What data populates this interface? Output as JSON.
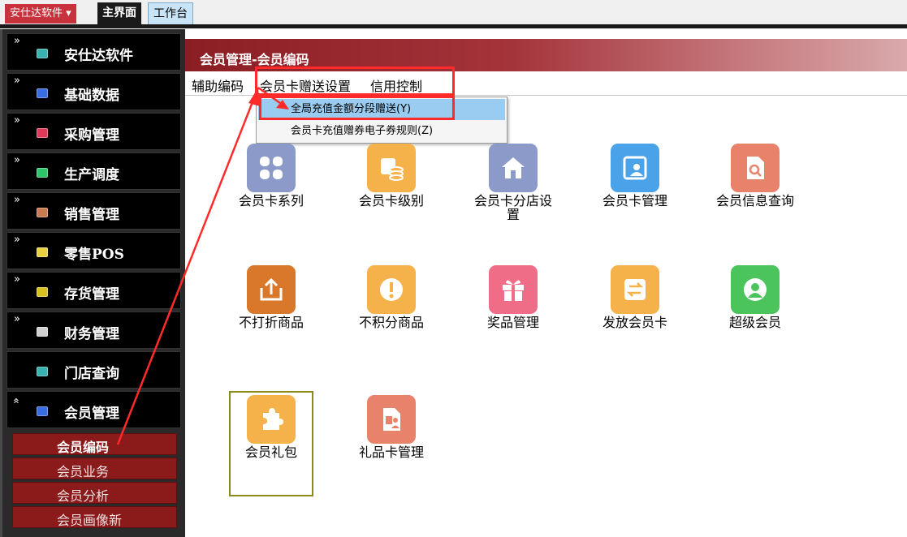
{
  "topbar": {
    "app_menu": "安仕达软件 ▾",
    "tabs": [
      "主界面",
      "工作台"
    ]
  },
  "sidebar": {
    "items": [
      {
        "label": "安仕达软件",
        "chevron": "»",
        "color": "#3ab0b0"
      },
      {
        "label": "基础数据",
        "chevron": "»",
        "color": "#3a6ee0"
      },
      {
        "label": "采购管理",
        "chevron": "»",
        "color": "#e03a5a"
      },
      {
        "label": "生产调度",
        "chevron": "»",
        "color": "#2ec46a"
      },
      {
        "label": "销售管理",
        "chevron": "»",
        "color": "#c87a50"
      },
      {
        "label": "零售POS",
        "chevron": "»",
        "color": "#e8d040"
      },
      {
        "label": "存货管理",
        "chevron": "»",
        "color": "#d8c020"
      },
      {
        "label": "财务管理",
        "chevron": "»",
        "color": "#d0d0d0"
      },
      {
        "label": "门店查询",
        "chevron": "",
        "color": "#3ab0b0"
      },
      {
        "label": "会员管理",
        "chevron": "«",
        "color": "#3a6ee0"
      }
    ],
    "subitems": [
      {
        "label": "会员编码",
        "active": true
      },
      {
        "label": "会员业务",
        "active": false
      },
      {
        "label": "会员分析",
        "active": false
      },
      {
        "label": "会员画像新",
        "active": false
      }
    ]
  },
  "panel": {
    "title": "会员管理-会员编码",
    "menu": [
      "辅助编码",
      "会员卡赠送设置",
      "信用控制"
    ],
    "dropdown": [
      {
        "label": "全局充值金额分段赠送(Y)",
        "highlighted": true
      },
      {
        "label": "会员卡充值赠券电子券规则(Z)",
        "highlighted": false
      }
    ]
  },
  "tiles": [
    {
      "label": "会员卡系列",
      "icon": "grid-icon",
      "color": "#8b9ac9"
    },
    {
      "label": "会员卡级别",
      "icon": "coins-icon",
      "color": "#f5b24a"
    },
    {
      "label": "会员卡分店设置",
      "icon": "home-icon",
      "color": "#8b9ac9"
    },
    {
      "label": "会员卡管理",
      "icon": "id-card-icon",
      "color": "#4aa3e8"
    },
    {
      "label": "会员信息查询",
      "icon": "doc-search-icon",
      "color": "#e8826a"
    },
    {
      "label": "不打折商品",
      "icon": "upload-icon",
      "color": "#d9782a"
    },
    {
      "label": "不积分商品",
      "icon": "alert-icon",
      "color": "#f5b24a"
    },
    {
      "label": "奖品管理",
      "icon": "gift-icon",
      "color": "#ef6d86"
    },
    {
      "label": "发放会员卡",
      "icon": "transfer-icon",
      "color": "#f5b24a"
    },
    {
      "label": "超级会员",
      "icon": "user-icon",
      "color": "#4cc45c"
    },
    {
      "label": "会员礼包",
      "icon": "puzzle-icon",
      "color": "#f5b24a"
    },
    {
      "label": "礼品卡管理",
      "icon": "card-doc-icon",
      "color": "#e8826a"
    }
  ]
}
